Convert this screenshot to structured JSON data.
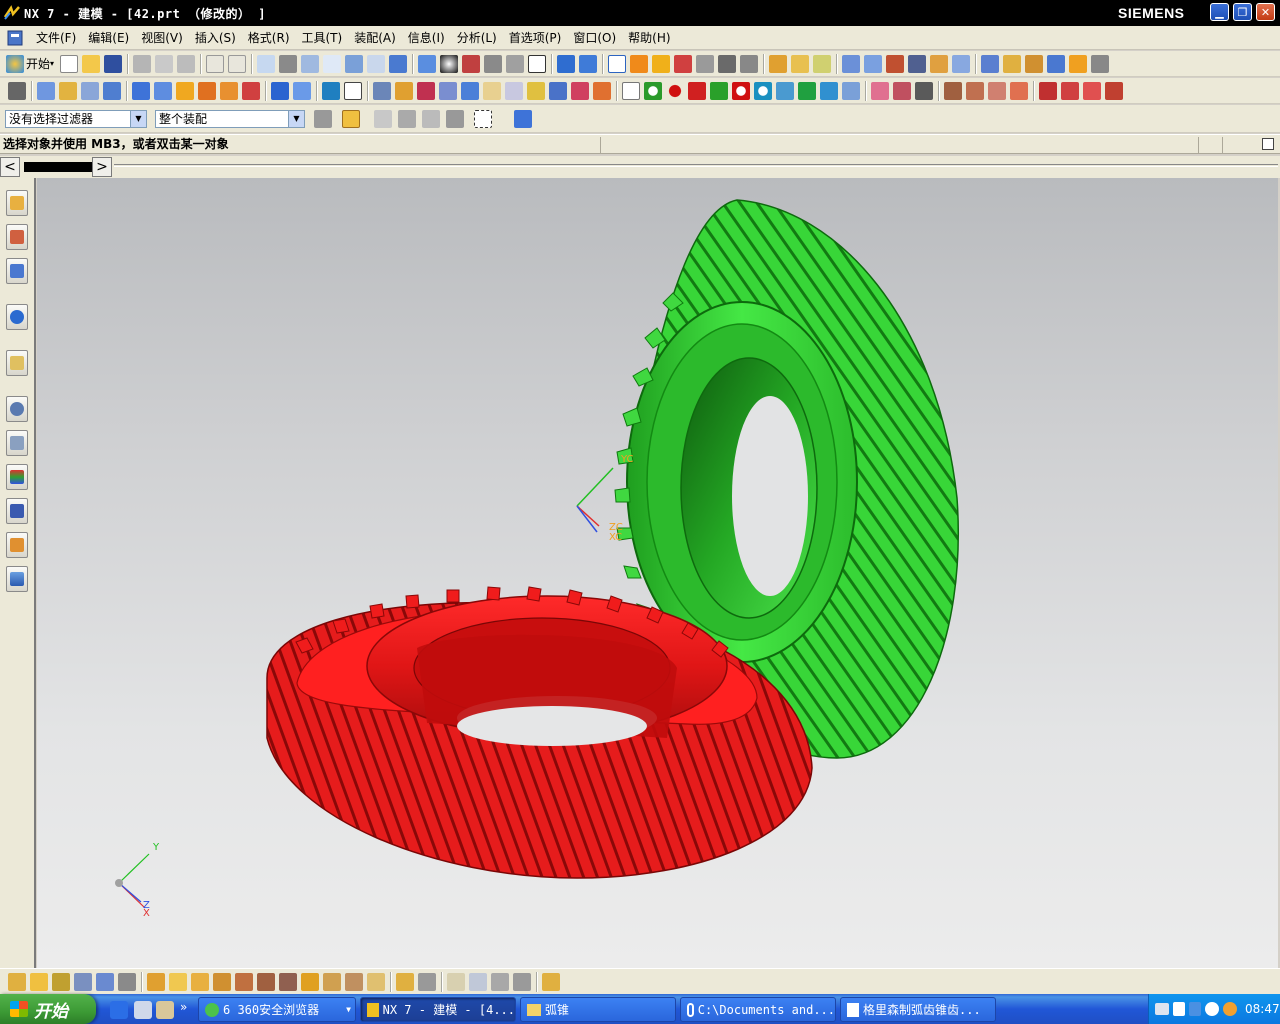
{
  "window": {
    "title": "NX 7 - 建模 - [42.prt （修改的） ]",
    "brand": "SIEMENS"
  },
  "menubar": {
    "items": [
      "文件(F)",
      "编辑(E)",
      "视图(V)",
      "插入(S)",
      "格式(R)",
      "工具(T)",
      "装配(A)",
      "信息(I)",
      "分析(L)",
      "首选项(P)",
      "窗口(O)",
      "帮助(H)"
    ]
  },
  "toolbar": {
    "start_label": "开始"
  },
  "selection_bar": {
    "type_filter": "没有选择过滤器",
    "scope_filter": "整个装配"
  },
  "cue_line": {
    "text": "选择对象并使用 MB3，或者双击某一对象"
  },
  "viewport": {
    "wcs_labels": {
      "yc": "YC",
      "zc": "ZC",
      "xc": "XC"
    },
    "triad_labels": {
      "y": "Y",
      "z": "Z",
      "x": "X"
    },
    "gear_colors": {
      "pinion": "#33d633",
      "ring": "#e61c1c"
    }
  },
  "taskbar": {
    "start_label": "开始",
    "buttons": [
      "6 360安全浏览器",
      "NX 7 - 建模 - [4...",
      "弧锥",
      "C:\\Documents and...",
      "格里森制弧齿锥齿..."
    ],
    "clock": "08:47"
  }
}
